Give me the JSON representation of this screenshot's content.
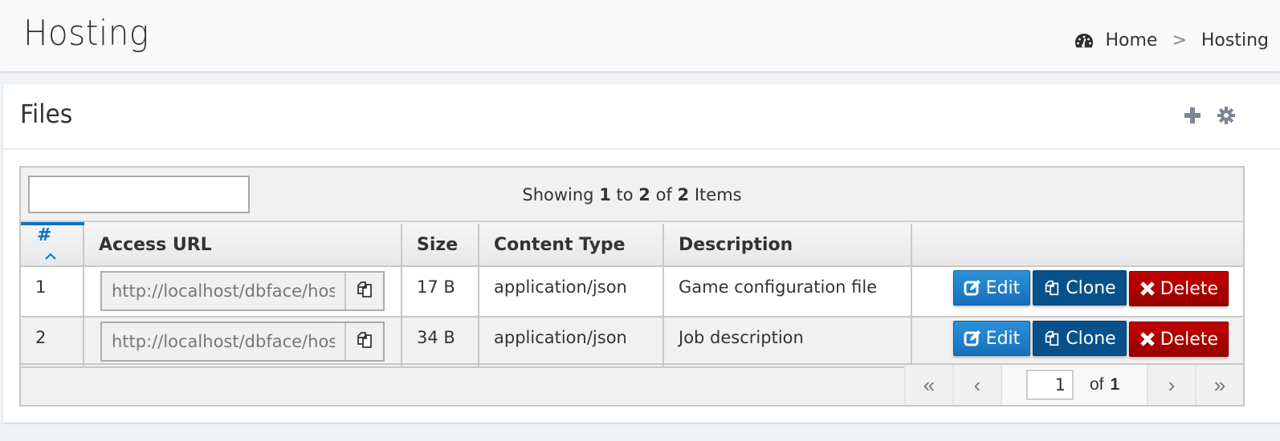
{
  "header": {
    "title": "Hosting",
    "breadcrumb": [
      {
        "label": "Home",
        "icon": "dashboard-icon"
      },
      {
        "label": "Hosting"
      }
    ],
    "breadcrumb_separator": ">"
  },
  "box": {
    "title": "Files",
    "tools": [
      {
        "name": "add",
        "icon": "plus-icon"
      },
      {
        "name": "settings",
        "icon": "gear-icon"
      }
    ]
  },
  "grid": {
    "search": {
      "value": "",
      "placeholder": ""
    },
    "status": {
      "prefix": "Showing",
      "from": "1",
      "to_word": "to",
      "to": "2",
      "of_word": "of",
      "total": "2",
      "suffix": "Items"
    },
    "columns": [
      {
        "label": "#",
        "sorted": "asc"
      },
      {
        "label": "Access URL"
      },
      {
        "label": "Size"
      },
      {
        "label": "Content Type"
      },
      {
        "label": "Description"
      },
      {
        "label": ""
      }
    ],
    "rows": [
      {
        "id": "1",
        "url": "http://localhost/dbface/hosting",
        "size": "17 B",
        "content_type": "application/json",
        "description": "Game configuration file"
      },
      {
        "id": "2",
        "url": "http://localhost/dbface/hosting",
        "size": "34 B",
        "content_type": "application/json",
        "description": "Job description"
      }
    ],
    "actions": {
      "edit": "Edit",
      "clone": "Clone",
      "delete": "Delete"
    },
    "pager": {
      "first": "«",
      "prev": "‹",
      "next": "›",
      "last": "»",
      "page": "1",
      "of_label": "of",
      "total_pages": "1"
    }
  },
  "colors": {
    "accent": "#0a74c4",
    "edit": "#1f80cc",
    "clone": "#08518b",
    "delete": "#b00000",
    "tool_icon": "#7d8596"
  }
}
